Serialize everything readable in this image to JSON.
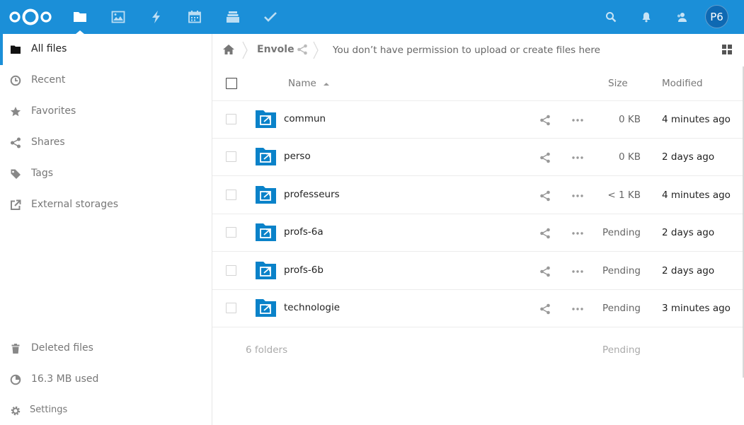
{
  "header": {
    "avatar_initials": "P6",
    "accent_color": "#1b8fd8",
    "apps": [
      {
        "name": "files",
        "icon": "folder-icon",
        "active": true
      },
      {
        "name": "photos",
        "icon": "image-icon"
      },
      {
        "name": "activity",
        "icon": "lightning-icon"
      },
      {
        "name": "calendar",
        "icon": "calendar-icon"
      },
      {
        "name": "deck",
        "icon": "stack-icon"
      },
      {
        "name": "tasks",
        "icon": "checkmark-icon"
      }
    ],
    "right_icons": [
      "search-icon",
      "bell-icon",
      "contacts-icon"
    ]
  },
  "sidebar": {
    "items": [
      {
        "label": "All files",
        "icon": "folder-icon",
        "active": true
      },
      {
        "label": "Recent",
        "icon": "clock-icon"
      },
      {
        "label": "Favorites",
        "icon": "star-icon"
      },
      {
        "label": "Shares",
        "icon": "share-icon"
      },
      {
        "label": "Tags",
        "icon": "tag-icon"
      },
      {
        "label": "External storages",
        "icon": "external-link-icon"
      }
    ],
    "bottom": {
      "deleted": "Deleted files",
      "quota": "16.3 MB used",
      "settings": "Settings"
    }
  },
  "breadcrumb": {
    "folder": "Envole",
    "message": "You don’t have permission to upload or create files here"
  },
  "table": {
    "headers": {
      "name": "Name",
      "size": "Size",
      "modified": "Modified"
    },
    "rows": [
      {
        "name": "commun",
        "size": "0 KB",
        "modified": "4 minutes ago"
      },
      {
        "name": "perso",
        "size": "0 KB",
        "modified": "2 days ago"
      },
      {
        "name": "professeurs",
        "size": "< 1 KB",
        "modified": "4 minutes ago"
      },
      {
        "name": "profs-6a",
        "size": "Pending",
        "modified": "2 days ago"
      },
      {
        "name": "profs-6b",
        "size": "Pending",
        "modified": "2 days ago"
      },
      {
        "name": "technologie",
        "size": "Pending",
        "modified": "3 minutes ago"
      }
    ],
    "summary": {
      "count": "6 folders",
      "size": "Pending"
    }
  }
}
